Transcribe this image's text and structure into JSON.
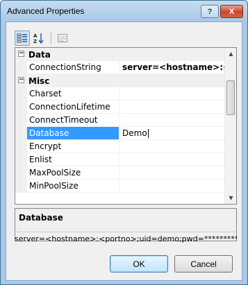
{
  "window": {
    "title": "Advanced Properties",
    "help_label": "?",
    "close_label": "X"
  },
  "toolbar": {
    "categorized_icon": "categorized-icon",
    "alphabetical_icon": "alphabetical-sort-icon",
    "property_pages_icon": "property-pages-icon"
  },
  "grid": {
    "categories": [
      {
        "name": "Data",
        "expander": "−"
      },
      {
        "name": "Misc",
        "expander": "−"
      }
    ],
    "properties": [
      {
        "name": "ConnectionString",
        "value": "server=<hostname>:<portno>;uid=demo;pwd="
      },
      {
        "name": "Charset",
        "value": ""
      },
      {
        "name": "ConnectionLifetime",
        "value": ""
      },
      {
        "name": "ConnectTimeout",
        "value": ""
      },
      {
        "name": "Database",
        "value": "Demo"
      },
      {
        "name": "Encrypt",
        "value": ""
      },
      {
        "name": "Enlist",
        "value": ""
      },
      {
        "name": "MaxPoolSize",
        "value": ""
      },
      {
        "name": "MinPoolSize",
        "value": ""
      }
    ],
    "selected": "Database"
  },
  "description": {
    "title": "Database"
  },
  "connection_string_preview": "server=<hostname>:<portno>;uid=demo;pwd=***********",
  "buttons": {
    "ok": "OK",
    "cancel": "Cancel"
  },
  "colors": {
    "selection": "#3399ff",
    "title_gradient_top": "#c4dcf1",
    "title_gradient_bottom": "#a9c8e6",
    "close_button": "#c8472a"
  }
}
